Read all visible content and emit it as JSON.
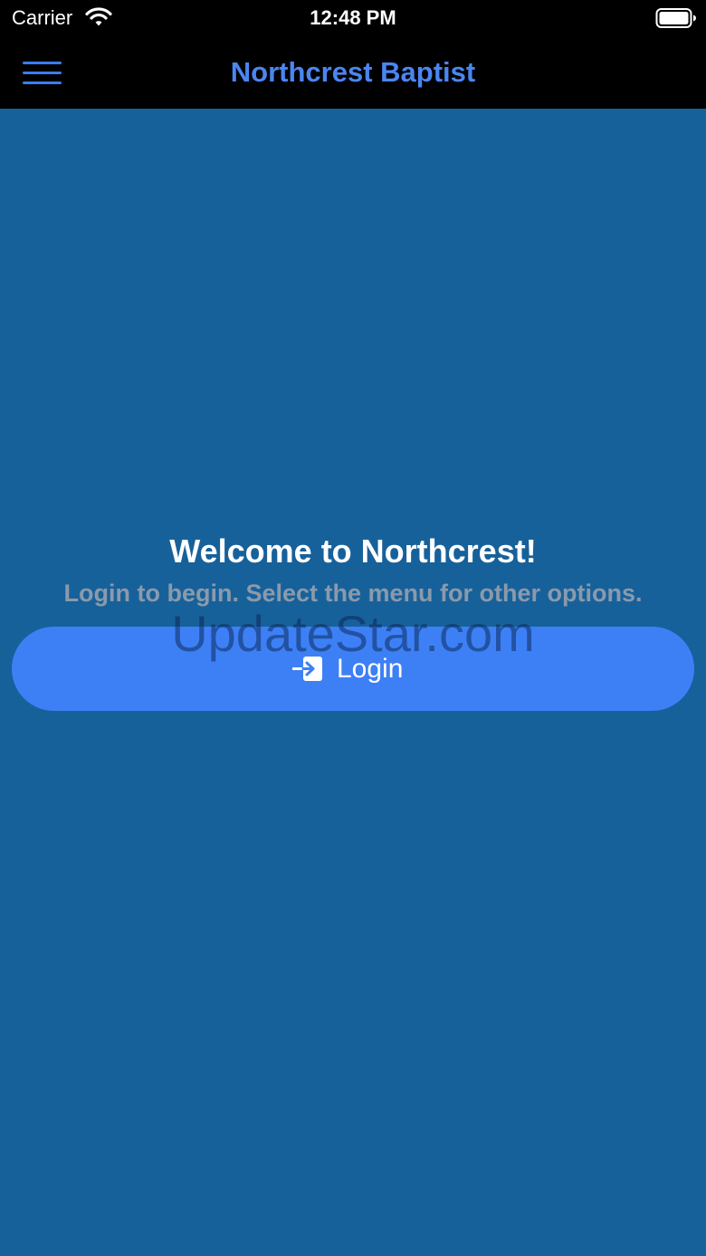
{
  "status_bar": {
    "carrier": "Carrier",
    "time": "12:48 PM",
    "wifi_icon": "wifi-icon",
    "battery_icon": "battery-icon"
  },
  "nav_bar": {
    "menu_icon": "hamburger-menu-icon",
    "title": "Northcrest Baptist",
    "title_color": "#4a86f2"
  },
  "main": {
    "welcome_title": "Welcome to Northcrest!",
    "welcome_subtitle": "Login to begin. Select the menu for other options.",
    "login_button": {
      "label": "Login",
      "icon": "login-arrow-icon",
      "color": "#3d80f6"
    },
    "background_color": "#17619b"
  },
  "watermark": "UpdateStar.com"
}
